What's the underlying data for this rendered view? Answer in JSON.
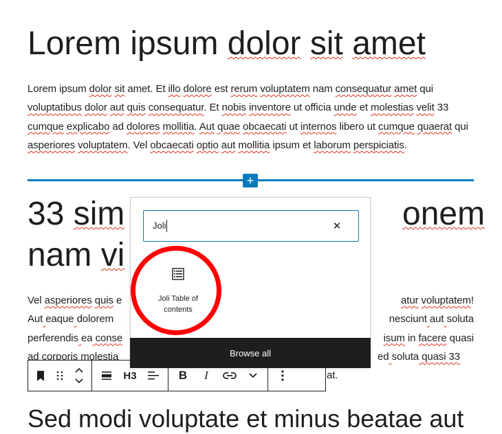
{
  "heading1": {
    "parts": [
      "Lorem ipsum ",
      "dolor",
      " ",
      "sit",
      " ",
      "amet"
    ]
  },
  "paragraph1": {
    "parts": [
      "Lorem ipsum ",
      "dolor",
      " ",
      "sit",
      " amet. Et ",
      "illo",
      " ",
      "dolore",
      " est ",
      "rerum",
      " ",
      "voluptatem",
      " nam ",
      "consequatur",
      " ",
      "amet",
      " qui ",
      "voluptatibus",
      " ",
      "dolor",
      " ",
      "aut",
      " ",
      "quis",
      " ",
      "consequatur",
      ". Et ",
      "nobis",
      " ",
      "inventore",
      " ut officia ",
      "unde",
      " et ",
      "molestias",
      " ",
      "velit",
      " 33 ",
      "cumque",
      " ",
      "explicabo",
      " ad ",
      "dolores",
      " ",
      "mollitia",
      ". ",
      "Aut",
      " ",
      "quae",
      " ",
      "obcaecati",
      " ut ",
      "internos",
      " libero ut ",
      "cumque",
      " ",
      "quaerat",
      " qui ",
      "asperiores",
      " ",
      "voluptatem",
      ". Vel ",
      "obcaecati",
      " ",
      "optio",
      " ",
      "aut",
      " ",
      "mollitia",
      " ipsum et ",
      "laborum",
      " ",
      "perspiciatis",
      "."
    ]
  },
  "heading2": {
    "line1a": [
      "33 ",
      "sim"
    ],
    "line1b": "onem",
    "line2": [
      "nam ",
      "vi"
    ]
  },
  "paragraph2": {
    "line1a": [
      "Vel ",
      "asperiores",
      " ",
      "quis",
      " e"
    ],
    "line1b": [
      "atur",
      " ",
      "voluptatem",
      "!"
    ],
    "line2a": [
      "Aut",
      " ",
      "eaque",
      " ",
      "dolorem"
    ],
    "line2b": [
      "nesciunt",
      " ",
      "aut",
      " ",
      "soluta"
    ],
    "line3a": [
      "perferendis",
      " ",
      "ea",
      " conse"
    ],
    "line3b": [
      "isum",
      " in ",
      "facere",
      " quasi"
    ],
    "line4a": [
      "ad",
      " ",
      "corporis",
      " ",
      "molestia"
    ],
    "line4b": [
      "ed",
      " ",
      "soluta",
      " quasi 33"
    ],
    "line5b": "at."
  },
  "heading3": {
    "text": "Sed modi voluptate et minus beatae aut"
  },
  "inserter_line": {
    "plus": "+"
  },
  "inserter": {
    "search_value": "Joli",
    "clear_symbol": "✕",
    "result_label": "Joli Table of contents",
    "browse_all": "Browse all"
  },
  "toolbar": {
    "heading_level": "H3",
    "bold": "B",
    "italic": "I"
  },
  "colors": {
    "accent": "#0a7aba",
    "highlight": "#ff0000",
    "spellcheck": "#e0301e",
    "dark": "#1e1e1e"
  }
}
